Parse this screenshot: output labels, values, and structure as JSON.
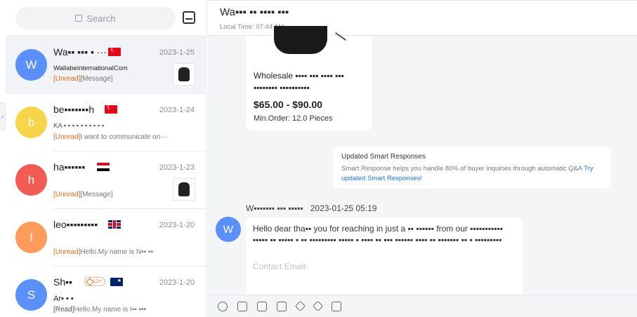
{
  "search": {
    "placeholder": "Search"
  },
  "conversations": [
    {
      "initial": "W",
      "name": "Wa▪▪ ▪▪▪ ▪ ···",
      "flag": "tr",
      "date": "2023-1-25",
      "company": "WallabeinternationalCom",
      "tag": "[Unread]",
      "preview": "[Message]",
      "avatar_color": "#5b8ff9"
    },
    {
      "initial": "b",
      "name": "be▪▪▪▪▪▪▪h",
      "flag": "tr",
      "date": "2023-1-24",
      "company": "KA ▪ ▪ ▪ ▪ ▪ ▪ ▪ ▪ ▪ ▪",
      "tag": "[Unread]",
      "preview": "I want to communicate on···",
      "avatar_color": "#f7d54a"
    },
    {
      "initial": "h",
      "name": "ha▪▪▪▪▪▪",
      "flag": "eg",
      "date": "2023-1-23",
      "company": "",
      "tag": "[Unread]",
      "preview": "[Message]",
      "avatar_color": "#f25c54"
    },
    {
      "initial": "l",
      "name": "leo▪▪▪▪▪▪▪▪▪",
      "flag": "gb",
      "date": "2023-1-20",
      "company": "",
      "tag": "[Unread]",
      "preview": "Hello.My name is N▪▪ ▪▪",
      "avatar_color": "#ff9b5a"
    },
    {
      "initial": "S",
      "name": "Sh▪▪",
      "flag": "au",
      "date": "2023-1-20",
      "company": "Ar▪ ▪ ▪",
      "tag": "[Read]",
      "preview": "Hello.My name is I▪▪ ▪▪▪",
      "avatar_color": "#5b8ff9",
      "vip": "L1+"
    }
  ],
  "chat": {
    "title": "Wa▪▪▪ ▪▪ ▪▪▪▪ ▪▪▪",
    "local_time": "Local Time: 07:44 AM",
    "product": {
      "name": "Wholesale ▪▪▪▪ ▪▪▪ ▪▪▪▪ ▪▪▪ ▪▪▪▪▪▪▪▪ ▪▪▪▪▪▪▪▪▪▪",
      "price": "$65.00 - $90.00",
      "moq": "Min.Order:   12.0 Pieces"
    },
    "smart": {
      "title": "Updated Smart Responses",
      "body": "Smart Response helps you handle 80% of buyer inquiries through automatic Q&A ",
      "link": "Try updated Smart Responses!"
    },
    "message": {
      "initial": "W",
      "sender": "W▪▪▪▪▪▪▪ ▪▪▪ ▪▪▪▪▪",
      "time": "2023-01-25 05:19",
      "body": "Hello dear tha▪▪ you for reaching in just a ▪▪ ▪▪▪▪▪▪ from our ▪▪▪▪▪▪▪▪▪▪▪ ▪▪▪▪▪ ▪▪ ▪▪▪▪▪ ▪ ▪▪ ▪▪▪▪▪▪▪▪▪ ▪▪▪▪▪ ▪ ▪▪▪▪ ▪▪ ▪▪▪ ▪▪▪▪▪▪ ▪▪▪▪ ▪▪ ▪▪▪▪▪▪▪ ▪▪ ▪ ▪▪▪▪▪▪▪▪▪",
      "footer": "Contact Email:"
    }
  },
  "toolbar": [
    "emoji-icon",
    "image-icon",
    "folder-icon",
    "copy-icon",
    "product-icon",
    "catalog-icon",
    "quote-icon"
  ]
}
